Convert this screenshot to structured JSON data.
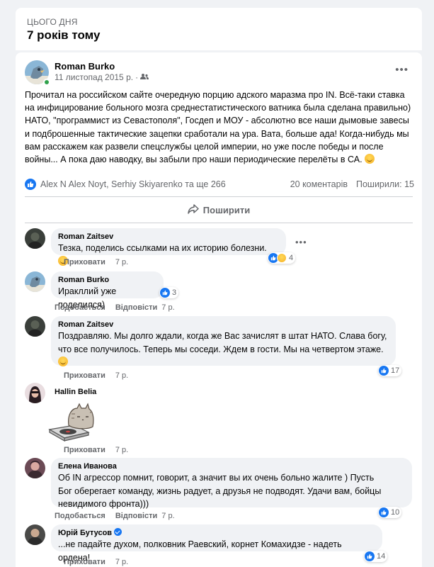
{
  "memory": {
    "overline": "ЦЬОГО ДНЯ",
    "title": "7 років тому"
  },
  "post": {
    "author": "Roman Burko",
    "date": "11 листопад 2015 р.",
    "audience_icon": "friends-icon",
    "body": "Прочитал на российском сайте очередную порцию адского маразма про IN. Всё-таки ставка на инфицирование больного мозга среднестатистического ватника была сделана правильно) НАТО, \"программист из Севастополя\", Госдеп и МОУ - абсолютно все наши дымовые завесы и подброшенные  тактические зацепки  сработали на ура. Вата, больше ада! Когда-нибудь мы вам расскажем как развели спецслужбы целой империи, но уже после победы и после войны... А пока даю наводку, вы забыли про наши периодические перелёты в СА.",
    "reactions_text": "Alex N Alex Noyt, Serhiy Skiyarenko та ще 266",
    "comments_count": "20 коментарів",
    "shares_count": "Поширили: 15",
    "share_label": "Поширити"
  },
  "comments": [
    {
      "name": "Roman Zaitsev",
      "text": "Тезка, поделись ссылками на их историю болезни.",
      "actions": [
        "Приховати"
      ],
      "time": "7 р.",
      "reactions": "4"
    },
    {
      "name": "Roman Burko",
      "text": "Иракллий уже поделился)",
      "actions": [
        "Подобається",
        "Відповісти"
      ],
      "time": "7 р.",
      "reactions": "3"
    },
    {
      "name": "Roman Zaitsev",
      "text_line1": "Поздравляю. Мы долго ждали, когда же Вас зачислят в штат НАТО. Слава богу,",
      "text_line2": "что все получилось. Теперь мы соседи. Ждем в гости. Мы на четвертом этаже.",
      "actions": [
        "Приховати"
      ],
      "time": "7 р.",
      "reactions": "17"
    },
    {
      "name": "Hallin Belia",
      "sticker": "pusheen-cat-sticker",
      "actions": [
        "Приховати"
      ],
      "time": "7 р."
    },
    {
      "name": "Елена Иванова",
      "text_line1": "Об IN агрессор помнит, говорит, а значит вы их очень больно жалите ) Пусть",
      "text_line2": "Бог оберегает команду, жизнь радует, а друзья не подводят. Удачи вам, бойцы",
      "text_line3": "невидимого фронта)))",
      "actions": [
        "Подобається",
        "Відповісти"
      ],
      "time": "7 р.",
      "reactions": "10"
    },
    {
      "name": "Юрій Бутусов",
      "text": "...не падайте духом, полковник Раевский, корнет Комахидзе - надеть ордена!",
      "actions": [
        "Приховати"
      ],
      "time": "7 р.",
      "reactions": "14"
    }
  ],
  "colors": {
    "accent": "#1877f2",
    "muted": "#65676b",
    "bubble": "#f0f2f5",
    "online": "#31a24c"
  }
}
